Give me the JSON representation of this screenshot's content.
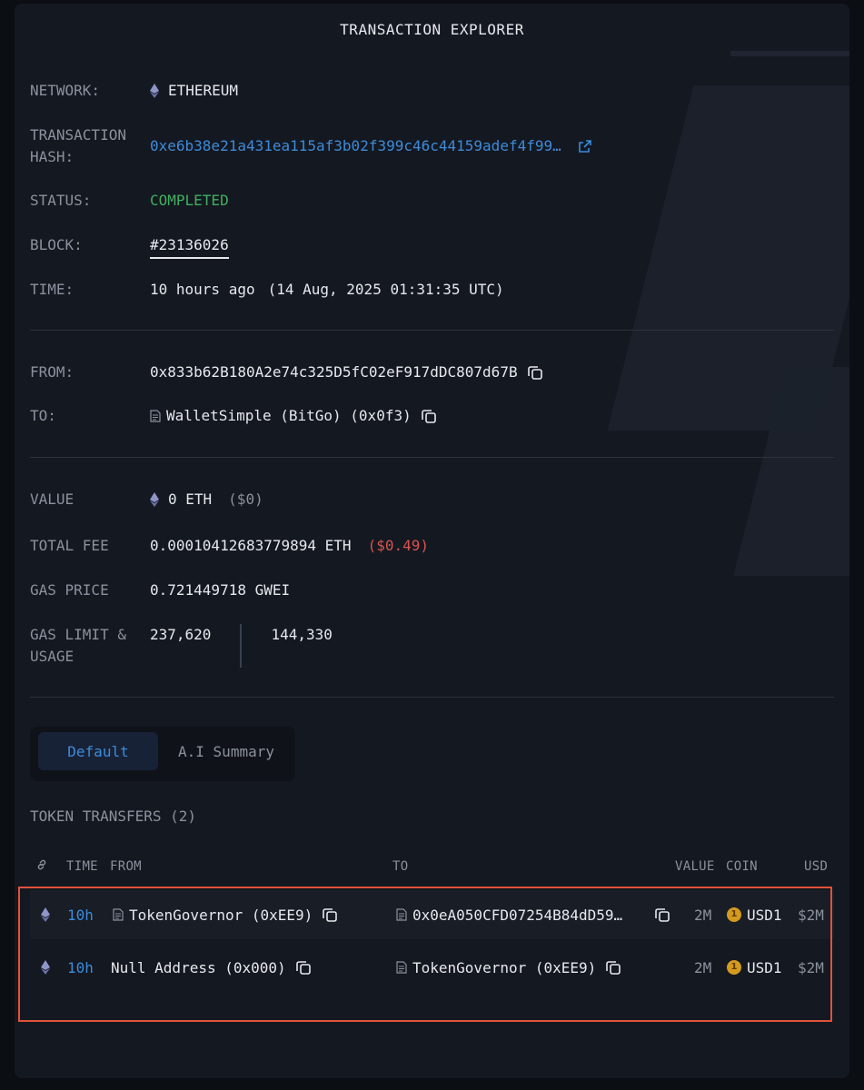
{
  "title": "TRANSACTION EXPLORER",
  "details": {
    "network_label": "NETWORK:",
    "network_value": "ETHEREUM",
    "hash_label_1": "TRANSACTION",
    "hash_label_2": "HASH:",
    "hash_value": "0xe6b38e21a431ea115af3b02f399c46c44159adef4f99…",
    "status_label": "STATUS:",
    "status_value": "COMPLETED",
    "block_label": "BLOCK:",
    "block_value": "#23136026",
    "time_label": "TIME:",
    "time_relative": "10 hours ago",
    "time_absolute": "(14 Aug, 2025 01:31:35 UTC)",
    "from_label": "FROM:",
    "from_value": "0x833b62B180A2e74c325D5fC02eF917dDC807d67B",
    "to_label": "TO:",
    "to_value": "WalletSimple (BitGo) (0x0f3)",
    "value_label": "VALUE",
    "value_eth": "0 ETH",
    "value_usd": "($0)",
    "fee_label": "TOTAL FEE",
    "fee_eth": "0.00010412683779894 ETH",
    "fee_usd": "($0.49)",
    "gas_price_label": "GAS PRICE",
    "gas_price_value": "0.721449718 GWEI",
    "gas_limit_label_1": "GAS LIMIT &",
    "gas_limit_label_2": "USAGE",
    "gas_limit_value": "237,620",
    "gas_usage_value": "144,330"
  },
  "tabs": {
    "default": "Default",
    "ai_summary": "A.I Summary"
  },
  "token_transfers": {
    "title": "TOKEN TRANSFERS (2)",
    "headers": {
      "time": "TIME",
      "from": "FROM",
      "to": "TO",
      "value": "VALUE",
      "coin": "COIN",
      "usd": "USD"
    },
    "rows": [
      {
        "time": "10h",
        "from": "TokenGovernor (0xEE9)",
        "to": "0x0eA050CFD07254B84dD59…",
        "value": "2M",
        "coin": "USD1",
        "usd": "$2M"
      },
      {
        "time": "10h",
        "from": "Null Address (0x000)",
        "to": "TokenGovernor (0xEE9)",
        "value": "2M",
        "coin": "USD1",
        "usd": "$2M"
      }
    ]
  },
  "coin_icon_text": "1",
  "colors": {
    "accent": "#3d8bd9",
    "status": "#3fae60",
    "fee_usd": "#d9534f",
    "highlight": "#e0523a"
  }
}
